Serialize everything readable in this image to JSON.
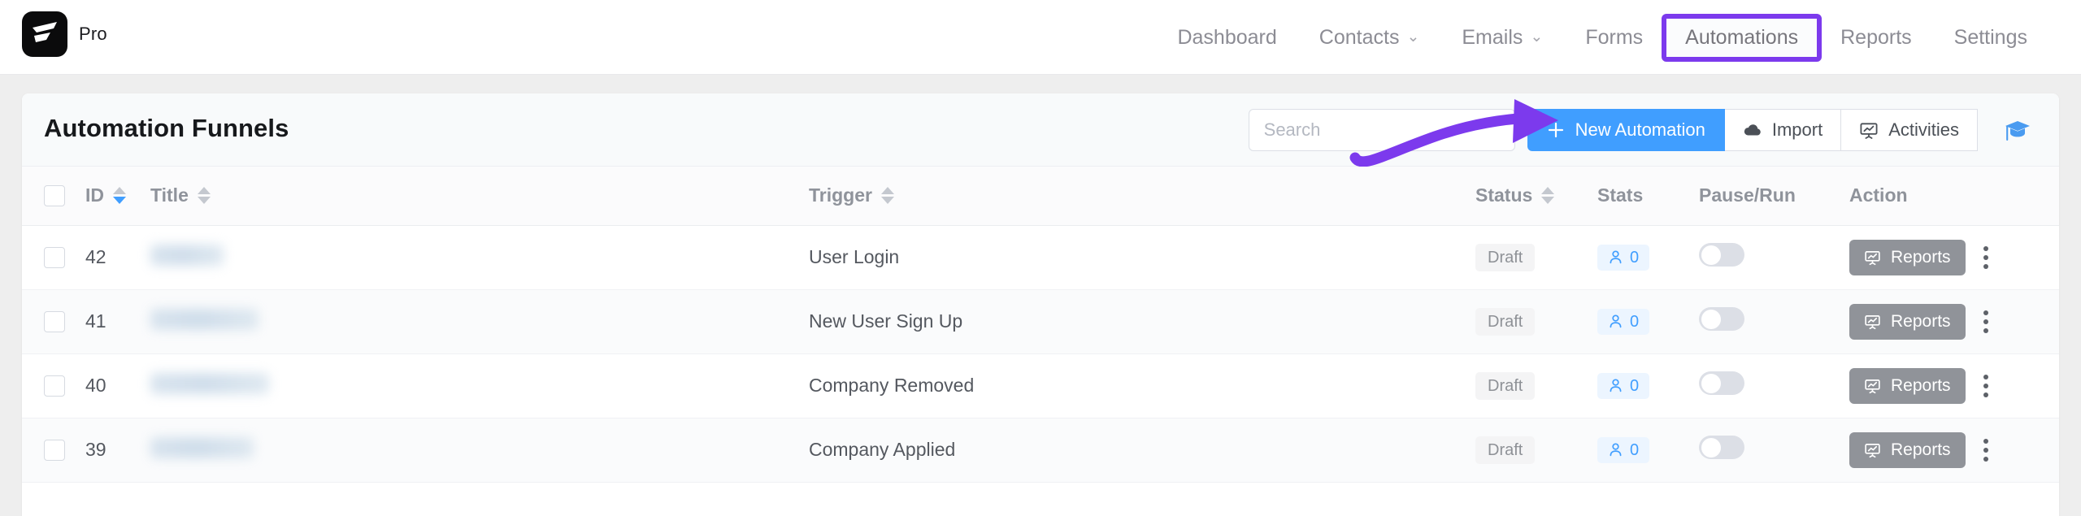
{
  "brand": {
    "name": "Pro",
    "logo_icon": "fluent-crm-logo-icon",
    "logo_bg": "#0b0b0c"
  },
  "nav": {
    "active": "Automations",
    "highlight_color": "#7c3aed",
    "items": [
      {
        "label": "Dashboard",
        "caret": ""
      },
      {
        "label": "Contacts",
        "caret": "⌄"
      },
      {
        "label": "Emails",
        "caret": "⌄"
      },
      {
        "label": "Forms",
        "caret": ""
      },
      {
        "label": "Automations",
        "caret": ""
      },
      {
        "label": "Reports",
        "caret": ""
      },
      {
        "label": "Settings",
        "caret": ""
      }
    ]
  },
  "card": {
    "title": "Automation Funnels",
    "search": {
      "value": "",
      "placeholder": "Search"
    },
    "buttons": {
      "new_automation": "New Automation",
      "new_automation_icon": "plus-icon",
      "new_automation_color": "#409eff",
      "import": "Import",
      "import_icon": "cloud-upload-icon",
      "activities": "Activities",
      "activities_icon": "presentation-chart-icon",
      "academy_icon": "graduation-cap-icon",
      "academy_color": "#409eff"
    }
  },
  "table": {
    "columns": [
      {
        "key": "check",
        "label": "",
        "sortable": false
      },
      {
        "key": "id",
        "label": "ID",
        "sortable": true,
        "sort_active": "desc"
      },
      {
        "key": "title",
        "label": "Title",
        "sortable": true,
        "sort_active": ""
      },
      {
        "key": "trigger",
        "label": "Trigger",
        "sortable": true,
        "sort_active": ""
      },
      {
        "key": "status",
        "label": "Status",
        "sortable": true,
        "sort_active": ""
      },
      {
        "key": "stats",
        "label": "Stats",
        "sortable": false
      },
      {
        "key": "pause_run",
        "label": "Pause/Run",
        "sortable": false
      },
      {
        "key": "action",
        "label": "Action",
        "sortable": false
      }
    ],
    "rows": [
      {
        "id": "42",
        "title_redacted": true,
        "title_width": 90,
        "trigger": "User Login",
        "status": "Draft",
        "stats_count": "0",
        "stats_icon": "user-icon",
        "toggle_on": false,
        "action_label": "Reports",
        "action_icon": "presentation-chart-icon",
        "menu_icon": "kebab-menu-icon"
      },
      {
        "id": "41",
        "title_redacted": true,
        "title_width": 133,
        "trigger": "New User Sign Up",
        "status": "Draft",
        "stats_count": "0",
        "stats_icon": "user-icon",
        "toggle_on": false,
        "action_label": "Reports",
        "action_icon": "presentation-chart-icon",
        "menu_icon": "kebab-menu-icon"
      },
      {
        "id": "40",
        "title_redacted": true,
        "title_width": 146,
        "trigger": "Company Removed",
        "status": "Draft",
        "stats_count": "0",
        "stats_icon": "user-icon",
        "toggle_on": false,
        "action_label": "Reports",
        "action_icon": "presentation-chart-icon",
        "menu_icon": "kebab-menu-icon"
      },
      {
        "id": "39",
        "title_redacted": true,
        "title_width": 127,
        "trigger": "Company Applied",
        "status": "Draft",
        "stats_count": "0",
        "stats_icon": "user-icon",
        "toggle_on": false,
        "action_label": "Reports",
        "action_icon": "presentation-chart-icon",
        "menu_icon": "kebab-menu-icon"
      }
    ]
  },
  "annotation": {
    "type": "curved-arrow",
    "color": "#7c3aed",
    "points_to": "New Automation"
  }
}
